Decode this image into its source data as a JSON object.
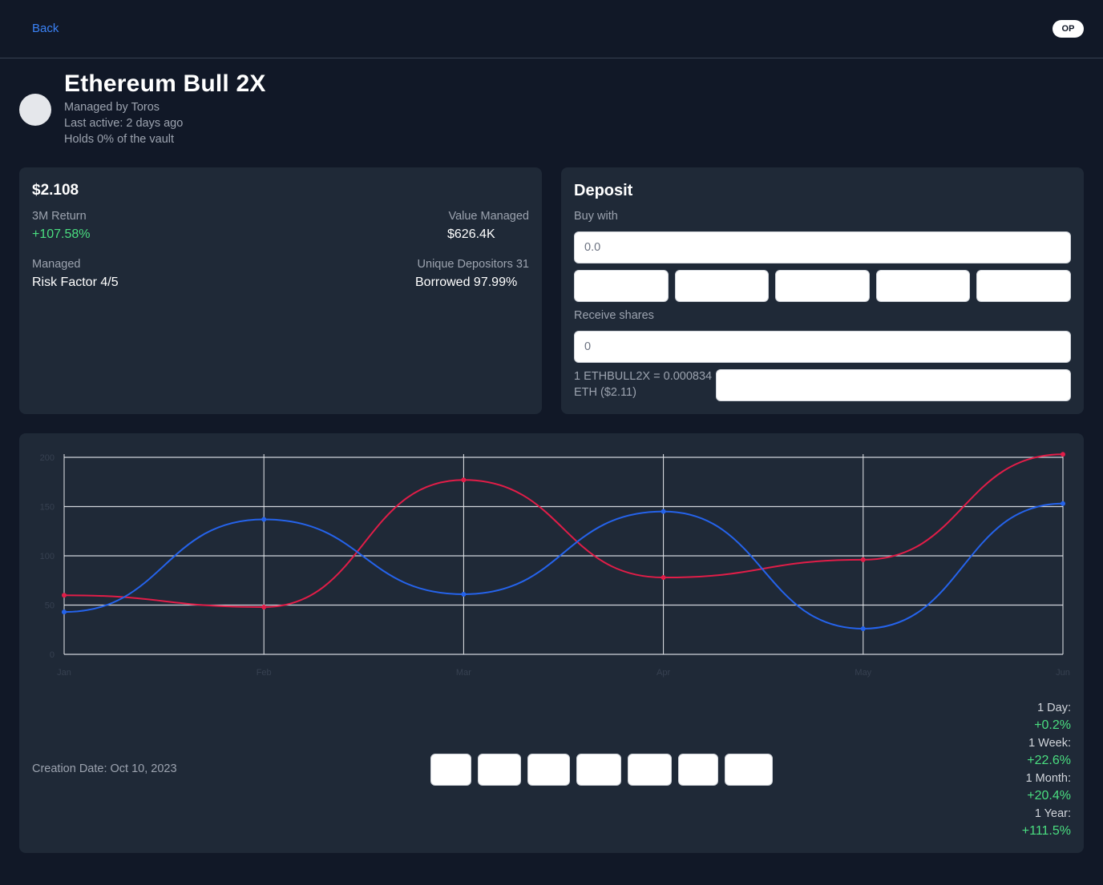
{
  "nav": {
    "back_label": "Back",
    "network_badge": "OP"
  },
  "vault": {
    "name": "Ethereum Bull 2X",
    "managed_by": "Managed by Toros",
    "last_active": "Last active: 2 days ago",
    "holds": "Holds 0% of the vault"
  },
  "stats": {
    "price": "$2.108",
    "return_label": "3M Return",
    "return_value": "+107.58%",
    "value_managed_label": "Value Managed",
    "value_managed": "$626.4K",
    "managed_label": "Managed",
    "risk_factor": "Risk Factor 4/5",
    "depositors_label": "Unique Depositors 31",
    "borrowed": "Borrowed 97.99%"
  },
  "deposit": {
    "title": "Deposit",
    "buy_with_label": "Buy with",
    "buy_placeholder": "0.0",
    "receive_label": "Receive shares",
    "receive_placeholder": "0",
    "rate": "1 ETHBULL2X = 0.000834 ETH ($2.11)"
  },
  "chart_data": {
    "type": "line",
    "x": [
      "Jan",
      "Feb",
      "Mar",
      "Apr",
      "May",
      "Jun"
    ],
    "ylim": [
      0,
      200
    ],
    "yticks": [
      0,
      50,
      100,
      150,
      200
    ],
    "grid": true,
    "series": [
      {
        "color": "#e11d48",
        "values": [
          60,
          48,
          177,
          78,
          96,
          203
        ]
      },
      {
        "color": "#2563eb",
        "values": [
          43,
          137,
          61,
          145,
          26,
          153
        ]
      }
    ]
  },
  "footer": {
    "creation_date": "Creation Date: Oct 10, 2023",
    "performance": [
      {
        "label": "1 Day:",
        "value": "+0.2%"
      },
      {
        "label": "1 Week:",
        "value": "+22.6%"
      },
      {
        "label": "1 Month:",
        "value": "+20.4%"
      },
      {
        "label": "1 Year:",
        "value": "+111.5%"
      }
    ]
  }
}
